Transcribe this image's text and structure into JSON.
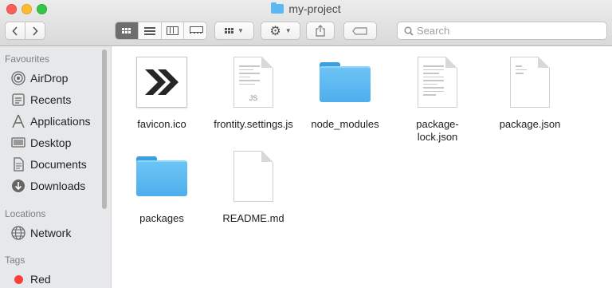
{
  "window": {
    "title": "my-project"
  },
  "toolbar": {
    "back_icon": "chevron-left-icon",
    "forward_icon": "chevron-right-icon",
    "view_modes": [
      "icon",
      "list",
      "column",
      "gallery"
    ],
    "active_view": "icon",
    "group_icon": "group-by-icon",
    "action_icon": "gear-icon",
    "share_icon": "share-icon",
    "tag_icon": "tag-icon"
  },
  "search": {
    "placeholder": "Search"
  },
  "sidebar": {
    "favourites_heading": "Favourites",
    "favourites": [
      {
        "label": "AirDrop",
        "icon": "airdrop-icon"
      },
      {
        "label": "Recents",
        "icon": "recents-icon"
      },
      {
        "label": "Applications",
        "icon": "applications-icon"
      },
      {
        "label": "Desktop",
        "icon": "desktop-icon"
      },
      {
        "label": "Documents",
        "icon": "documents-icon"
      },
      {
        "label": "Downloads",
        "icon": "downloads-icon"
      }
    ],
    "locations_heading": "Locations",
    "locations": [
      {
        "label": "Network",
        "icon": "network-icon"
      }
    ],
    "tags_heading": "Tags",
    "tags": [
      {
        "label": "Red",
        "color": "#fc3d39"
      }
    ]
  },
  "files": [
    {
      "name": "favicon.ico",
      "kind": "image",
      "icon": "favicon-icon"
    },
    {
      "name": "frontity.settings.js",
      "kind": "document",
      "badge": "JS",
      "icon": "js-file-icon"
    },
    {
      "name": "node_modules",
      "kind": "folder",
      "icon": "folder-icon"
    },
    {
      "name": "package-\nlock.json",
      "kind": "document",
      "icon": "json-file-icon"
    },
    {
      "name": "package.json",
      "kind": "document",
      "icon": "json-file-icon"
    },
    {
      "name": "packages",
      "kind": "folder",
      "icon": "folder-icon"
    },
    {
      "name": "README.md",
      "kind": "document",
      "icon": "markdown-file-icon"
    }
  ],
  "colors": {
    "folder": "#5cb8f0",
    "tag_red": "#fc3d39",
    "active_segment": "#6e6e6e"
  }
}
